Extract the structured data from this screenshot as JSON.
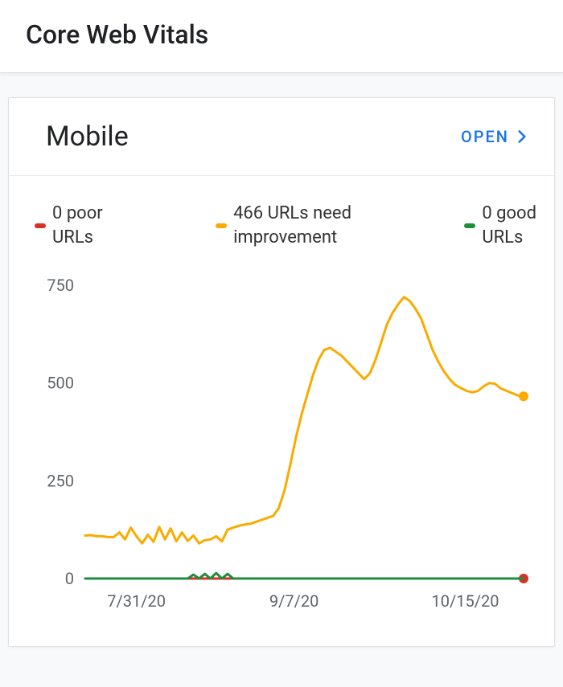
{
  "header": {
    "title": "Core Web Vitals"
  },
  "card": {
    "title": "Mobile",
    "open_label": "OPEN"
  },
  "legend": {
    "poor": {
      "count": 0,
      "label_tmpl": "{n} poor\nURLs"
    },
    "ni": {
      "count": 466,
      "label_tmpl": "{n} URLs need\nimprovement"
    },
    "good": {
      "count": 0,
      "label_tmpl": "{n} good\nURLs"
    }
  },
  "colors": {
    "poor": "#d93025",
    "ni": "#f9ab00",
    "good": "#1e8e3e",
    "axis": "#5f6368"
  },
  "chart_data": {
    "type": "line",
    "xlabel": "",
    "ylabel": "",
    "ylim": [
      0,
      750
    ],
    "y_ticks": [
      0,
      250,
      500,
      750
    ],
    "x_tick_labels": [
      "7/31/20",
      "9/7/20",
      "10/15/20"
    ],
    "x_tick_positions": [
      0.05,
      0.42,
      0.79
    ],
    "x_range_days": 90,
    "series": [
      {
        "name": "URLs need improvement",
        "color_key": "ni",
        "end_marker": true,
        "values": [
          110,
          111,
          108,
          108,
          106,
          106,
          118,
          100,
          130,
          108,
          90,
          112,
          94,
          132,
          100,
          128,
          95,
          118,
          96,
          110,
          90,
          98,
          100,
          108,
          95,
          125,
          130,
          135,
          138,
          140,
          145,
          150,
          155,
          160,
          180,
          225,
          290,
          360,
          420,
          470,
          520,
          560,
          585,
          590,
          580,
          570,
          555,
          540,
          525,
          510,
          525,
          560,
          605,
          650,
          680,
          702,
          720,
          710,
          690,
          665,
          625,
          585,
          555,
          530,
          510,
          495,
          487,
          480,
          476,
          480,
          492,
          500,
          498,
          486,
          480,
          474,
          468,
          466
        ]
      },
      {
        "name": "poor URLs",
        "color_key": "poor",
        "end_marker": true,
        "values": [
          0,
          0,
          0,
          0,
          0,
          0,
          0,
          0,
          0,
          0,
          0,
          0,
          0,
          0,
          0,
          0,
          0,
          0,
          0,
          0,
          0,
          0,
          0,
          0,
          0,
          0,
          0,
          0,
          0,
          0,
          0,
          0,
          0,
          0,
          0,
          0,
          0,
          0,
          0,
          0,
          0,
          0,
          0,
          0,
          0,
          0,
          0,
          0,
          0,
          0,
          0,
          0,
          0,
          0,
          0,
          0,
          0,
          0,
          0,
          0,
          0,
          0,
          0,
          0,
          0,
          0,
          0,
          0,
          0,
          0,
          0,
          0,
          0,
          0,
          0,
          0,
          0,
          0
        ]
      },
      {
        "name": "good URLs",
        "color_key": "good",
        "end_marker": false,
        "values": [
          0,
          0,
          0,
          0,
          0,
          0,
          0,
          0,
          0,
          0,
          0,
          0,
          0,
          0,
          0,
          0,
          0,
          0,
          0,
          10,
          0,
          12,
          0,
          14,
          0,
          12,
          0,
          0,
          0,
          0,
          0,
          0,
          0,
          0,
          0,
          0,
          0,
          0,
          0,
          0,
          0,
          0,
          0,
          0,
          0,
          0,
          0,
          0,
          0,
          0,
          0,
          0,
          0,
          0,
          0,
          0,
          0,
          0,
          0,
          0,
          0,
          0,
          0,
          0,
          0,
          0,
          0,
          0,
          0,
          0,
          0,
          0,
          0,
          0,
          0,
          0,
          0,
          0
        ]
      }
    ]
  }
}
